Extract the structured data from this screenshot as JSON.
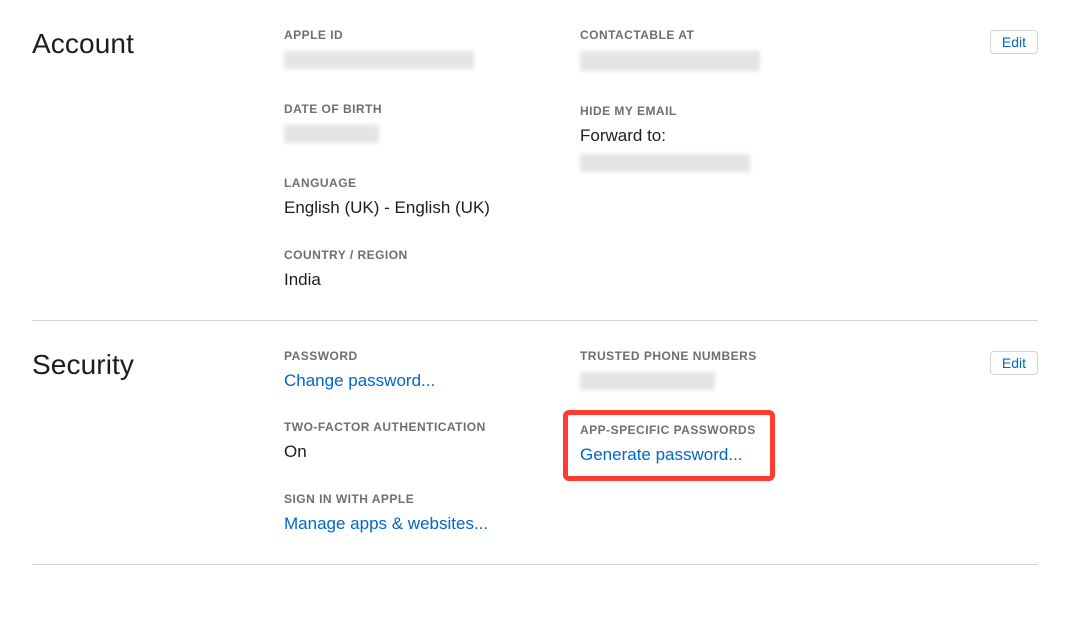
{
  "account": {
    "title": "Account",
    "edit_label": "Edit",
    "apple_id": {
      "label": "APPLE ID"
    },
    "dob": {
      "label": "DATE OF BIRTH"
    },
    "language": {
      "label": "LANGUAGE",
      "value": "English (UK) - English (UK)"
    },
    "country": {
      "label": "COUNTRY / REGION",
      "value": "India"
    },
    "contactable": {
      "label": "CONTACTABLE AT"
    },
    "hide_email": {
      "label": "HIDE MY EMAIL",
      "forward_label": "Forward to:"
    }
  },
  "security": {
    "title": "Security",
    "edit_label": "Edit",
    "password": {
      "label": "PASSWORD",
      "link": "Change password..."
    },
    "two_factor": {
      "label": "TWO-FACTOR AUTHENTICATION",
      "value": "On"
    },
    "sign_in_apple": {
      "label": "SIGN IN WITH APPLE",
      "link": "Manage apps & websites..."
    },
    "trusted_phone": {
      "label": "TRUSTED PHONE NUMBERS"
    },
    "app_passwords": {
      "label": "APP-SPECIFIC PASSWORDS",
      "link": "Generate password..."
    }
  }
}
